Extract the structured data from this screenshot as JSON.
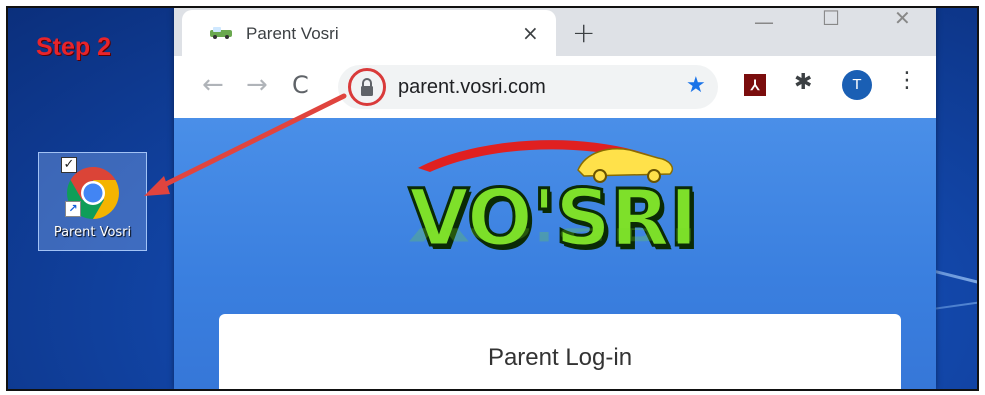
{
  "annotation": {
    "step_label": "Step 2"
  },
  "desktop": {
    "shortcut": {
      "label": "Parent Vosri",
      "icon": "chrome-icon",
      "checked": true
    }
  },
  "browser": {
    "tab": {
      "title": "Parent Vosri",
      "close_glyph": "×"
    },
    "new_tab_glyph": "+",
    "window_controls": {
      "minimize": "—",
      "maximize": "☐",
      "close": "✕"
    },
    "toolbar": {
      "back_glyph": "←",
      "forward_glyph": "→",
      "reload_glyph": "C",
      "url": "parent.vosri.com",
      "bookmark_glyph": "★",
      "profile_initial": "T",
      "menu_glyph": "⋮",
      "extension_glyph": "✱"
    }
  },
  "page": {
    "logo_text": "VO'SRI",
    "login_heading": "Parent Log-in"
  },
  "colors": {
    "desktop_blue": "#1246a8",
    "page_blue": "#3a7fdf",
    "step_red": "#e8242b",
    "logo_green": "#7ee02a",
    "accent_blue": "#1a73e8"
  }
}
